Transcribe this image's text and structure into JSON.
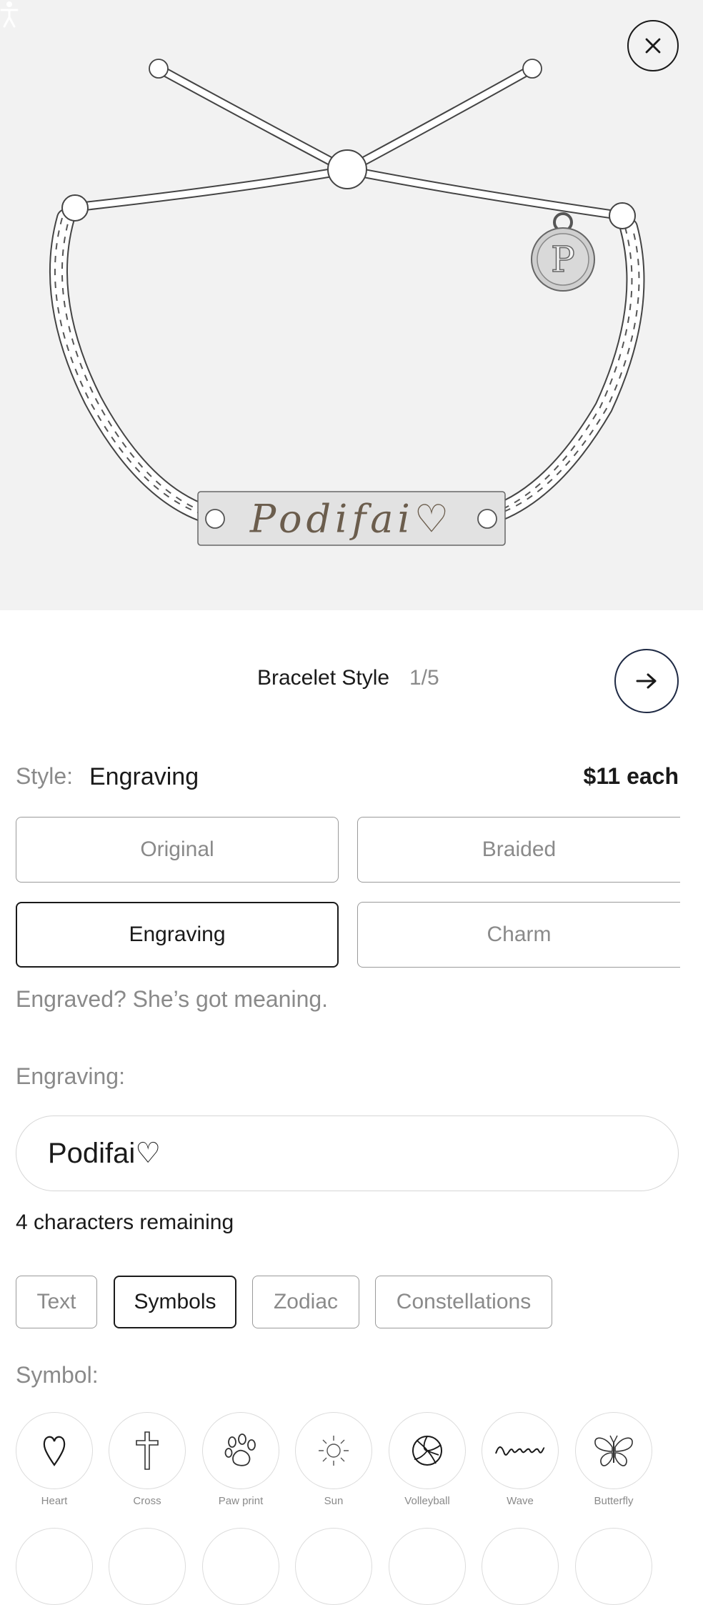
{
  "preview": {
    "engraving_text": "Podifai♡",
    "charm_letter": "P"
  },
  "step": {
    "title": "Bracelet Style",
    "count": "1/5"
  },
  "style": {
    "label": "Style:",
    "value": "Engraving",
    "price": "$11 each",
    "options": [
      {
        "label": "Original",
        "selected": false
      },
      {
        "label": "Braided",
        "selected": false
      },
      {
        "label": "Engraving",
        "selected": true
      },
      {
        "label": "Charm",
        "selected": false
      }
    ],
    "tagline": "Engraved? She’s got meaning."
  },
  "engraving": {
    "label": "Engraving:",
    "value": "Podifai♡",
    "remaining": "4 characters remaining"
  },
  "tabs": [
    {
      "label": "Text",
      "selected": false
    },
    {
      "label": "Symbols",
      "selected": true
    },
    {
      "label": "Zodiac",
      "selected": false
    },
    {
      "label": "Constellations",
      "selected": false
    }
  ],
  "symbols": {
    "label": "Symbol:",
    "items": [
      {
        "name": "Heart",
        "icon": "heart-icon"
      },
      {
        "name": "Cross",
        "icon": "cross-icon"
      },
      {
        "name": "Paw print",
        "icon": "paw-print-icon"
      },
      {
        "name": "Sun",
        "icon": "sun-icon"
      },
      {
        "name": "Volleyball",
        "icon": "volleyball-icon"
      },
      {
        "name": "Wave",
        "icon": "wave-icon"
      },
      {
        "name": "Butterfly",
        "icon": "butterfly-icon"
      }
    ]
  },
  "colors": {
    "hero_bg": "#f2f2f2",
    "accent_navy": "#1f2a44",
    "muted_text": "#8a8a8a",
    "engraving_ink": "#6b5d4d"
  }
}
